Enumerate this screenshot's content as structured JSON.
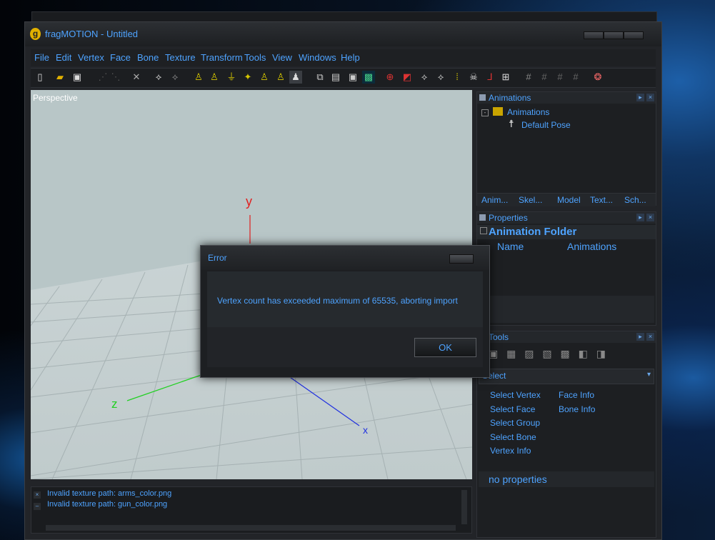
{
  "window": {
    "title": "fragMOTION - Untitled"
  },
  "menu": [
    "File",
    "Edit",
    "Vertex",
    "Face",
    "Bone",
    "Texture",
    "Transform",
    "Tools",
    "View",
    "Windows",
    "Help"
  ],
  "viewport": {
    "label": "Perspective",
    "axes": {
      "y": "y",
      "z": "z",
      "x": "x"
    }
  },
  "log": {
    "lines": [
      "Invalid texture path: arms_color.png",
      "Invalid texture path: gun_color.png"
    ]
  },
  "animations_panel": {
    "title": "Animations",
    "tree": {
      "root": "Animations",
      "child": "Default Pose"
    },
    "tabs": [
      "Anim...",
      "Skel...",
      "Model",
      "Text...",
      "Sch..."
    ]
  },
  "properties_panel": {
    "title": "Properties",
    "heading": "Animation Folder",
    "columns": [
      "Name",
      "Animations"
    ]
  },
  "tools_panel": {
    "title": "Tools",
    "dropdown": "Select",
    "left_items": [
      "Select Vertex",
      "Select Face",
      "Select Group",
      "Select Bone",
      "Vertex Info"
    ],
    "right_items": [
      "Face Info",
      "Bone Info"
    ],
    "footer": "no properties"
  },
  "dialog": {
    "title": "Error",
    "message": "Vertex count has exceeded maximum of 65535, aborting import",
    "ok_label": "OK"
  },
  "colors": {
    "accent": "#4ea3ff",
    "viewport_bg": "#b8c6c7"
  }
}
